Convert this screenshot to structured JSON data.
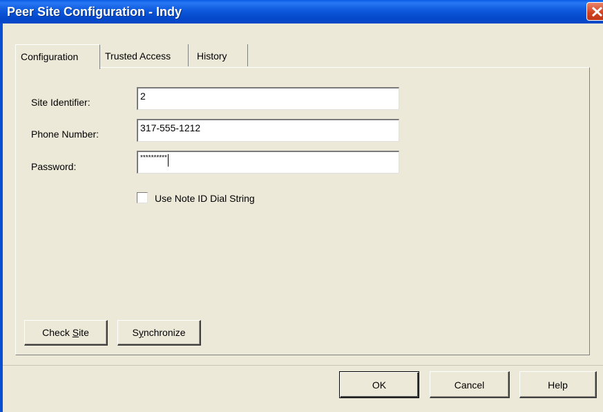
{
  "window": {
    "title": "Peer Site Configuration - Indy"
  },
  "tabs": [
    {
      "label": "Configuration",
      "active": true
    },
    {
      "label": "Trusted Access",
      "active": false
    },
    {
      "label": "History",
      "active": false
    }
  ],
  "form": {
    "site_identifier_label": "Site Identifier:",
    "site_identifier_value": "2",
    "phone_number_label": "Phone Number:",
    "phone_number_value": "317-555-1212",
    "password_label": "Password:",
    "password_value": "**********",
    "use_note_id_label": "Use Note ID Dial String",
    "use_note_id_checked": false
  },
  "panel_buttons": {
    "check_site_pre": "Check ",
    "check_site_mnemonic": "S",
    "check_site_post": "ite",
    "synchronize_pre": "S",
    "synchronize_mnemonic": "y",
    "synchronize_post": "nchronize"
  },
  "dialog_buttons": {
    "ok": "OK",
    "cancel": "Cancel",
    "help": "Help"
  },
  "colors": {
    "titlebar": "#0447c9",
    "dialog_bg": "#ece9d8",
    "close_btn": "#d0421e"
  },
  "icons": {
    "close": "close-icon"
  }
}
